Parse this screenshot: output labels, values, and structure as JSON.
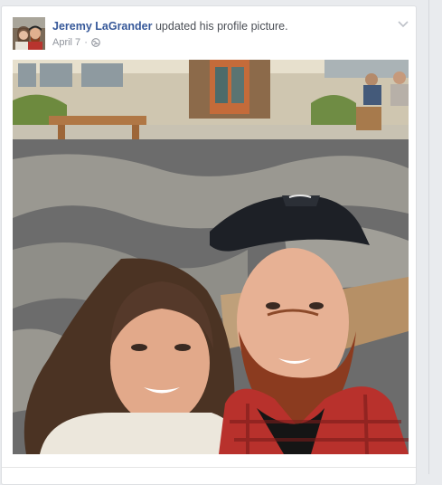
{
  "post": {
    "author": "Jeremy LaGrander",
    "action": " updated his profile picture.",
    "date": "April 7",
    "separator": "·",
    "privacy_icon": "globe-icon",
    "options_icon": "chevron-down-icon"
  },
  "colors": {
    "author_link": "#365899",
    "meta_text": "#90949c",
    "card_border": "#dddfe2",
    "page_background": "#e9ebee"
  }
}
